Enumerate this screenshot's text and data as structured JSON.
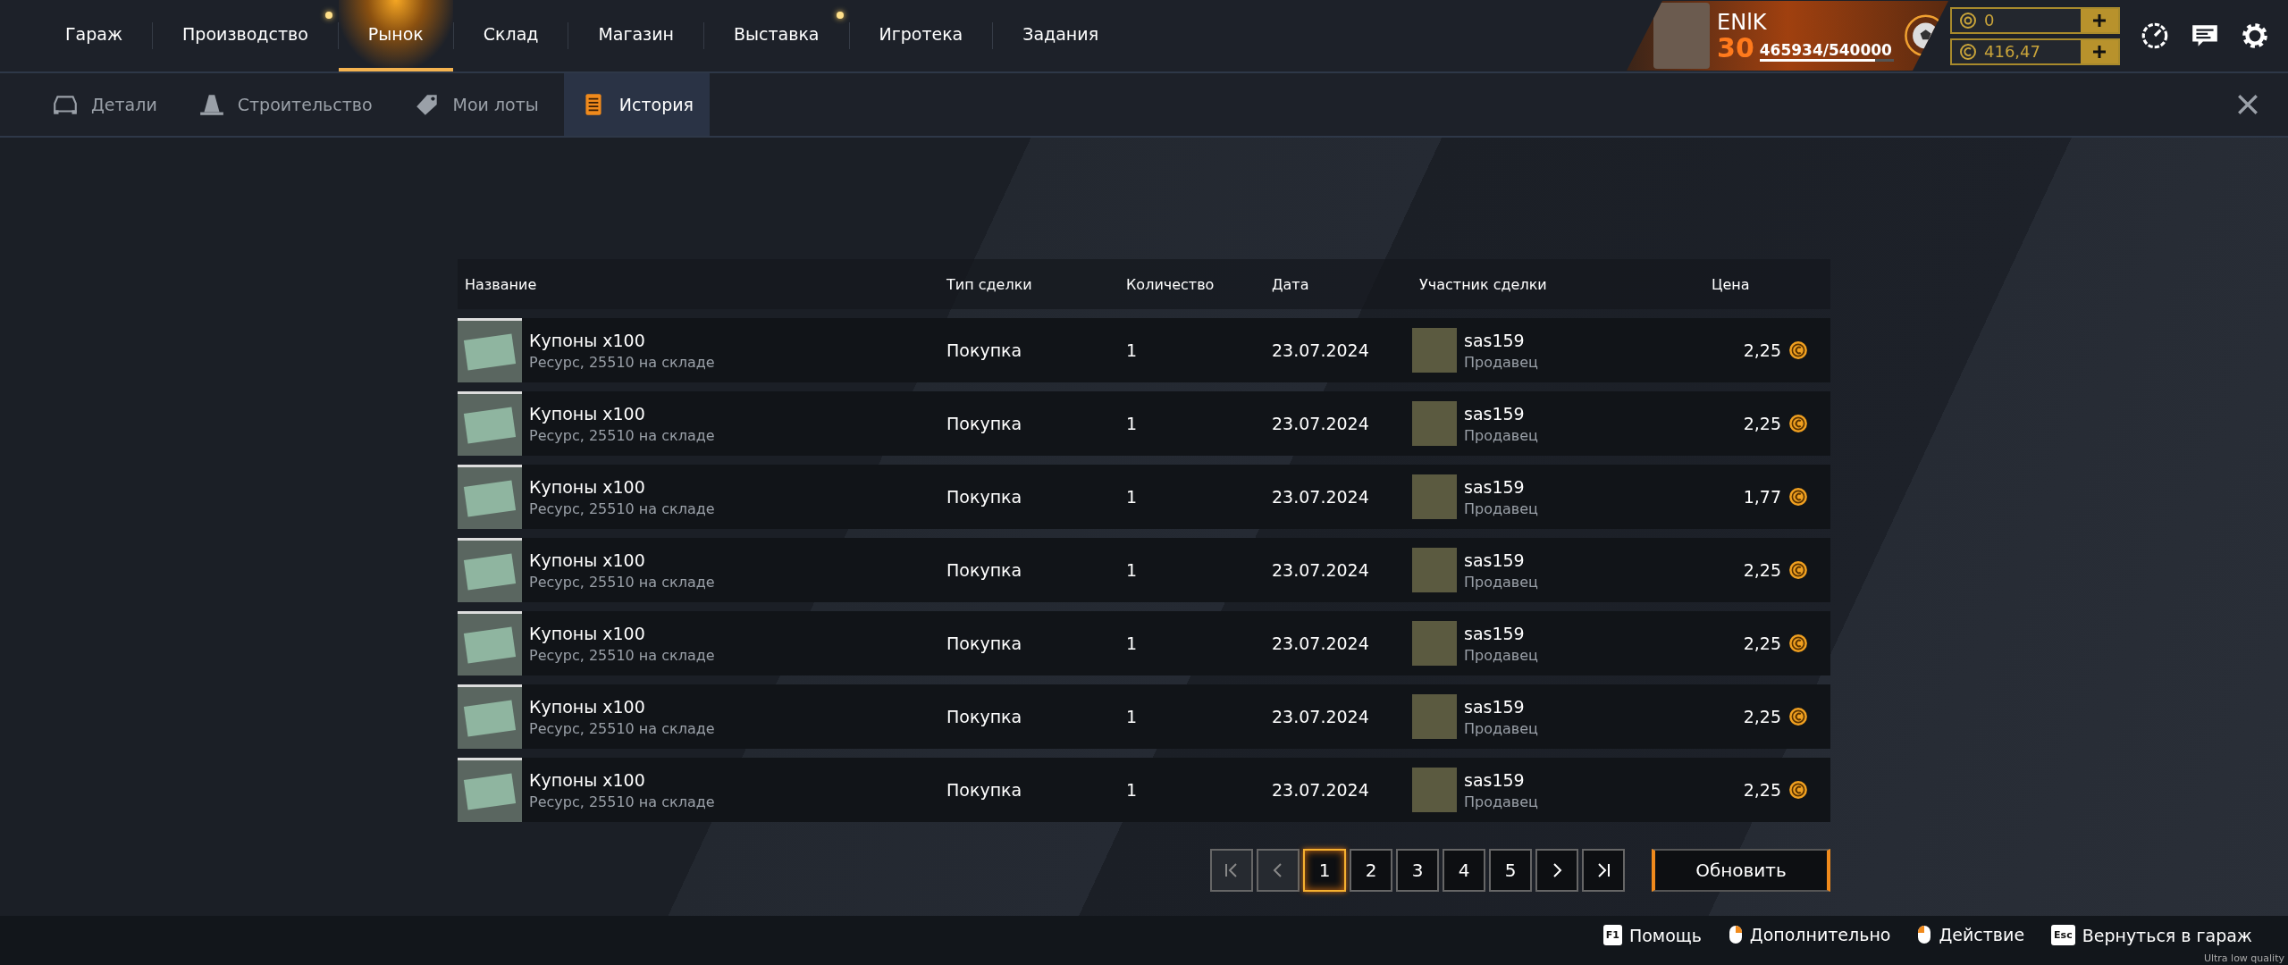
{
  "nav": [
    {
      "label": "Гараж",
      "selected": false,
      "notification": false
    },
    {
      "label": "Производство",
      "selected": false,
      "notification": true
    },
    {
      "label": "Рынок",
      "selected": true,
      "notification": false
    },
    {
      "label": "Склад",
      "selected": false,
      "notification": false
    },
    {
      "label": "Магазин",
      "selected": false,
      "notification": false
    },
    {
      "label": "Выставка",
      "selected": false,
      "notification": true
    },
    {
      "label": "Игротека",
      "selected": false,
      "notification": false
    },
    {
      "label": "Задания",
      "selected": false,
      "notification": false
    }
  ],
  "profile": {
    "name": "ENlK",
    "level_number": "30",
    "xp": "465934/540000",
    "level": 0.86
  },
  "currencies": [
    {
      "kind": "coupon",
      "amount": "0"
    },
    {
      "kind": "coin",
      "amount": "416,47"
    }
  ],
  "subtabs": [
    {
      "kind": "car",
      "label": "Детали",
      "selected": false
    },
    {
      "kind": "cone",
      "label": "Строительство",
      "selected": false
    },
    {
      "kind": "tag",
      "label": "Мои лоты",
      "selected": false
    },
    {
      "kind": "list",
      "label": "История",
      "selected": true
    }
  ],
  "table": {
    "columns": [
      "Название",
      "Тип сделки",
      "Количество",
      "Дата",
      "Участник сделки",
      "Цена"
    ],
    "rows": [
      {
        "name": "Купоны x100",
        "detail": "Ресурс, 25510 на складе",
        "type": "Покупка",
        "quantity": "1",
        "date": "23.07.2024",
        "participant": "sas159",
        "role": "Продавец",
        "price": "2,25"
      },
      {
        "name": "Купоны x100",
        "detail": "Ресурс, 25510 на складе",
        "type": "Покупка",
        "quantity": "1",
        "date": "23.07.2024",
        "participant": "sas159",
        "role": "Продавец",
        "price": "2,25"
      },
      {
        "name": "Купоны x100",
        "detail": "Ресурс, 25510 на складе",
        "type": "Покупка",
        "quantity": "1",
        "date": "23.07.2024",
        "participant": "sas159",
        "role": "Продавец",
        "price": "1,77"
      },
      {
        "name": "Купоны x100",
        "detail": "Ресурс, 25510 на складе",
        "type": "Покупка",
        "quantity": "1",
        "date": "23.07.2024",
        "participant": "sas159",
        "role": "Продавец",
        "price": "2,25"
      },
      {
        "name": "Купоны x100",
        "detail": "Ресурс, 25510 на складе",
        "type": "Покупка",
        "quantity": "1",
        "date": "23.07.2024",
        "participant": "sas159",
        "role": "Продавец",
        "price": "2,25"
      },
      {
        "name": "Купоны x100",
        "detail": "Ресурс, 25510 на складе",
        "type": "Покупка",
        "quantity": "1",
        "date": "23.07.2024",
        "participant": "sas159",
        "role": "Продавец",
        "price": "2,25"
      },
      {
        "name": "Купоны x100",
        "detail": "Ресурс, 25510 на складе",
        "type": "Покупка",
        "quantity": "1",
        "date": "23.07.2024",
        "participant": "sas159",
        "role": "Продавец",
        "price": "2,25"
      }
    ]
  },
  "pagination": {
    "pages": [
      {
        "label": "1",
        "selected": true
      },
      {
        "label": "2",
        "selected": false
      },
      {
        "label": "3",
        "selected": false
      },
      {
        "label": "4",
        "selected": false
      },
      {
        "label": "5",
        "selected": false
      }
    ]
  },
  "refresh_button": "Обновить",
  "hints": [
    {
      "kind": "key",
      "key": "F1",
      "label": "Помощь"
    },
    {
      "kind": "mouse-right",
      "label": "Дополнительно"
    },
    {
      "kind": "mouse-left",
      "label": "Действие"
    },
    {
      "kind": "key",
      "key": "Esc",
      "label": "Вернуться в гараж"
    }
  ],
  "quality_label": "Ultra low quality"
}
